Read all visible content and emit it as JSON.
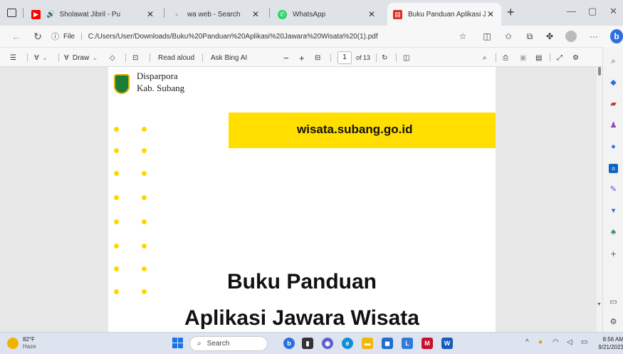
{
  "tabs": [
    {
      "title": "Sholawat Jibril - Pu",
      "icon": "youtube-icon",
      "color": "#ff0000"
    },
    {
      "title": "wa web - Search",
      "icon": "search-icon",
      "color": "#888888"
    },
    {
      "title": "WhatsApp",
      "icon": "whatsapp-icon",
      "color": "#25d366"
    },
    {
      "title": "Buku Panduan Aplikasi Jaw",
      "icon": "pdf-icon",
      "color": "#d93025"
    }
  ],
  "address": {
    "scheme_label": "File",
    "url": "C:/Users/User/Downloads/Buku%20Panduan%20Aplikasi%20Jawara%20Wisata%20(1).pdf"
  },
  "pdf_toolbar": {
    "draw_label": "Draw",
    "read_aloud_label": "Read aloud",
    "ask_bing_label": "Ask Bing AI",
    "page_current": "1",
    "page_total": "of 13"
  },
  "document": {
    "org_line1": "Disparpora",
    "org_line2": "Kab. Subang",
    "banner_text": "wisata.subang.go.id",
    "title_line1": "Buku Panduan",
    "title_line2": "Aplikasi Jawara Wisata",
    "accent_color": "#ffde00"
  },
  "taskbar": {
    "temperature": "82°F",
    "weather_text": "Haze",
    "search_placeholder": "Search",
    "time": "8:56 AM",
    "date": "9/21/2023"
  }
}
